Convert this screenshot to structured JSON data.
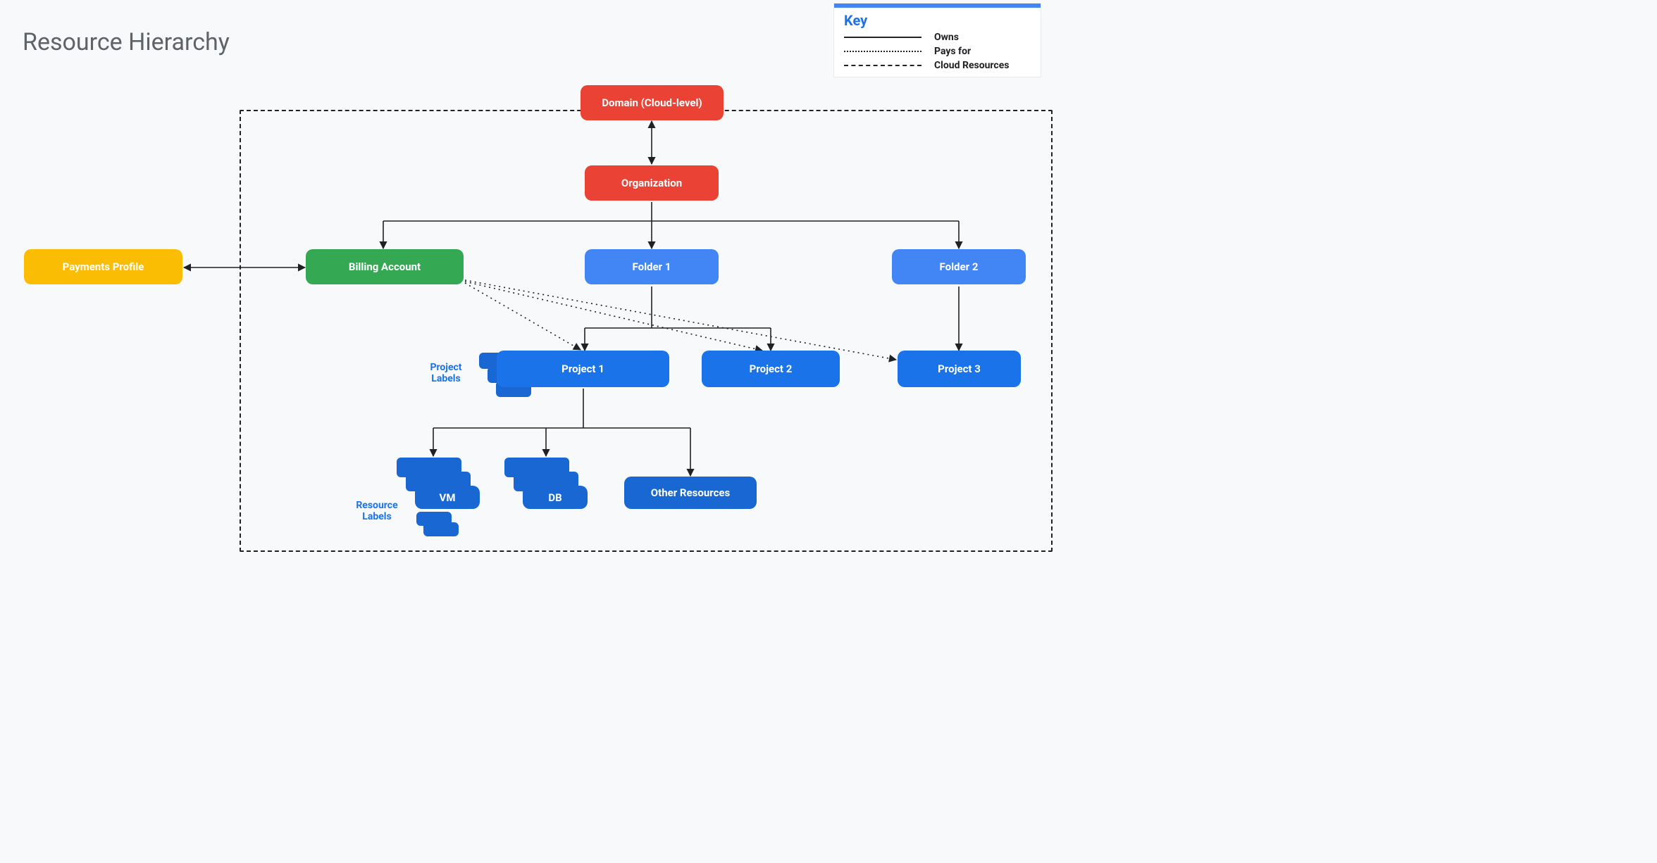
{
  "title": "Resource Hierarchy",
  "key": {
    "heading": "Key",
    "items": [
      {
        "style": "solid",
        "label": "Owns"
      },
      {
        "style": "dotted",
        "label": "Pays for"
      },
      {
        "style": "dashed",
        "label": "Cloud Resources"
      }
    ]
  },
  "nodes": {
    "domain": "Domain (Cloud-level)",
    "organization": "Organization",
    "payments_profile": "Payments Profile",
    "billing_account": "Billing Account",
    "folder1": "Folder 1",
    "folder2": "Folder 2",
    "project1": "Project 1",
    "project2": "Project 2",
    "project3": "Project 3",
    "vm": "VM",
    "db": "DB",
    "other_resources": "Other Resources"
  },
  "labels": {
    "project_labels": "Project\nLabels",
    "resource_labels": "Resource\nLabels"
  }
}
